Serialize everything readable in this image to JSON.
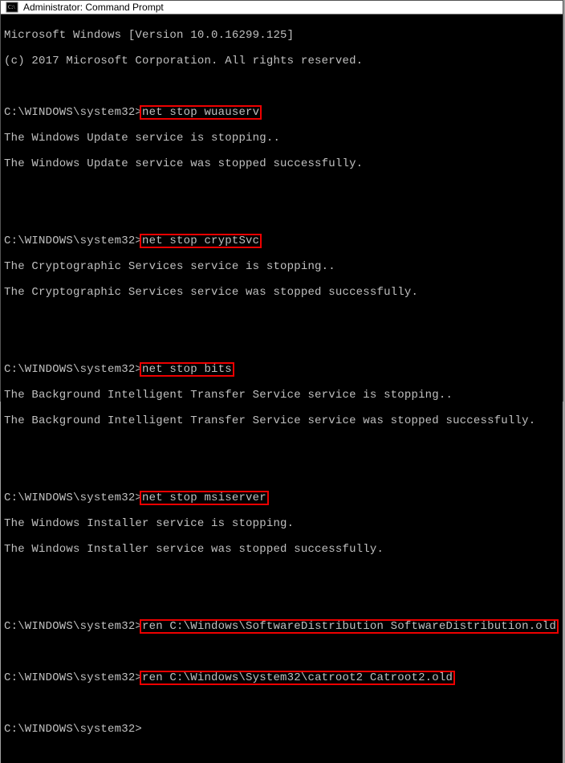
{
  "title": "Administrator: Command Prompt",
  "header": {
    "line1": "Microsoft Windows [Version 10.0.16299.125]",
    "line2": "(c) 2017 Microsoft Corporation. All rights reserved."
  },
  "prompt": "C:\\WINDOWS\\system32>",
  "blocks": [
    {
      "cmd": "net stop wuauserv",
      "out1": "The Windows Update service is stopping..",
      "out2": "The Windows Update service was stopped successfully."
    },
    {
      "cmd": "net stop cryptSvc",
      "out1": "The Cryptographic Services service is stopping..",
      "out2": "The Cryptographic Services service was stopped successfully."
    },
    {
      "cmd": "net stop bits",
      "out1": "The Background Intelligent Transfer Service service is stopping..",
      "out2": "The Background Intelligent Transfer Service service was stopped successfully."
    },
    {
      "cmd": "net stop msiserver",
      "out1": "The Windows Installer service is stopping.",
      "out2": "The Windows Installer service was stopped successfully."
    }
  ],
  "rename": [
    "ren C:\\Windows\\SoftwareDistribution SoftwareDistribution.old",
    "ren C:\\Windows\\System32\\catroot2 Catroot2.old"
  ]
}
